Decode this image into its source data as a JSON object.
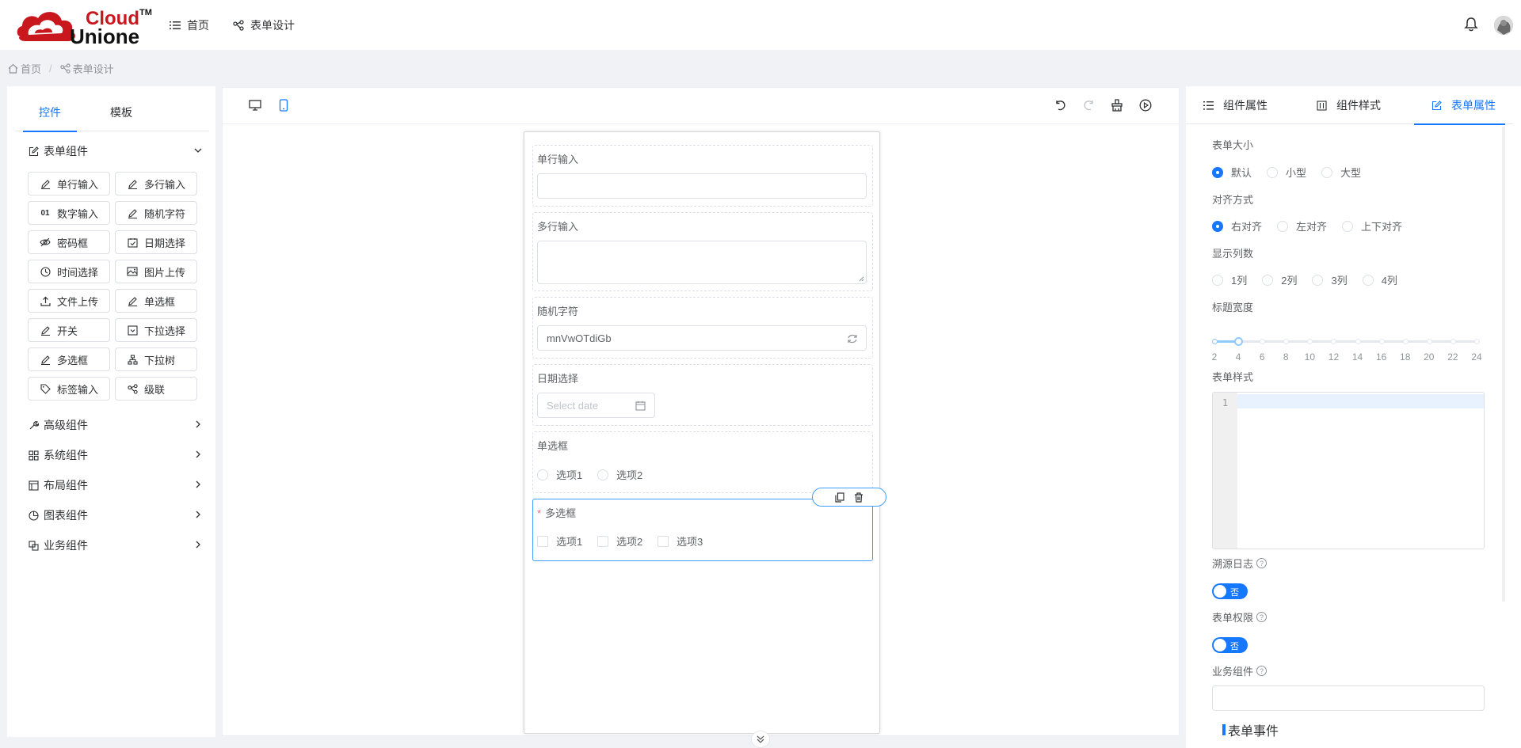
{
  "brand": {
    "line1": "Cloud",
    "tm": "TM",
    "line2": "Unione"
  },
  "topnav": [
    {
      "label": "首页",
      "icon": "list-icon"
    },
    {
      "label": "表单设计",
      "icon": "share-nodes-icon"
    }
  ],
  "breadcrumb": {
    "home": "首页",
    "separator": "/",
    "current": "表单设计"
  },
  "left_tabs": [
    "控件",
    "模板"
  ],
  "left_groups": {
    "form": "表单组件",
    "advanced": "高级组件",
    "system": "系统组件",
    "layout": "布局组件",
    "chart": "图表组件",
    "business": "业务组件"
  },
  "controls": [
    {
      "label": "单行输入",
      "icon": "pen-icon"
    },
    {
      "label": "多行输入",
      "icon": "pen-icon"
    },
    {
      "label": "数字输入",
      "icon": "01"
    },
    {
      "label": "随机字符",
      "icon": "pen-icon"
    },
    {
      "label": "密码框",
      "icon": "eye-off-icon"
    },
    {
      "label": "日期选择",
      "icon": "calendar-check-icon"
    },
    {
      "label": "时间选择",
      "icon": "clock-icon"
    },
    {
      "label": "图片上传",
      "icon": "image-icon"
    },
    {
      "label": "文件上传",
      "icon": "upload-icon"
    },
    {
      "label": "单选框",
      "icon": "pen-icon"
    },
    {
      "label": "开关",
      "icon": "pen-icon"
    },
    {
      "label": "下拉选择",
      "icon": "select-box-icon"
    },
    {
      "label": "多选框",
      "icon": "pen-icon"
    },
    {
      "label": "下拉树",
      "icon": "tree-icon"
    },
    {
      "label": "标签输入",
      "icon": "tag-icon"
    },
    {
      "label": "级联",
      "icon": "share-nodes-icon"
    }
  ],
  "form": {
    "single_input": {
      "label": "单行输入",
      "value": ""
    },
    "multi_input": {
      "label": "多行输入",
      "value": ""
    },
    "random": {
      "label": "随机字符",
      "value": "mnVwOTdiGb"
    },
    "date": {
      "label": "日期选择",
      "placeholder": "Select date"
    },
    "radio": {
      "label": "单选框",
      "options": [
        "选项1",
        "选项2"
      ]
    },
    "checkbox": {
      "label": "多选框",
      "required_mark": "*",
      "options": [
        "选项1",
        "选项2",
        "选项3"
      ]
    }
  },
  "right_tabs": [
    "组件属性",
    "组件样式",
    "表单属性"
  ],
  "props": {
    "size_label": "表单大小",
    "size_options": [
      "默认",
      "小型",
      "大型"
    ],
    "size_selected": "默认",
    "align_label": "对齐方式",
    "align_options": [
      "右对齐",
      "左对齐",
      "上下对齐"
    ],
    "align_selected": "右对齐",
    "cols_label": "显示列数",
    "cols_options": [
      "1列",
      "2列",
      "3列",
      "4列"
    ],
    "title_width_label": "标题宽度",
    "title_width": {
      "min": 2,
      "max": 24,
      "step": 2,
      "value": 4,
      "marks": [
        "2",
        "4",
        "6",
        "8",
        "10",
        "12",
        "14",
        "16",
        "18",
        "20",
        "22",
        "24"
      ]
    },
    "style_label": "表单样式",
    "editor_line": "1",
    "trace_label": "溯源日志",
    "trace_value": "否",
    "perm_label": "表单权限",
    "perm_value": "否",
    "biz_label": "业务组件",
    "biz_value": "",
    "events_title": "表单事件"
  },
  "colors": {
    "accent": "#1677ff",
    "brand_red": "#c8181e"
  }
}
